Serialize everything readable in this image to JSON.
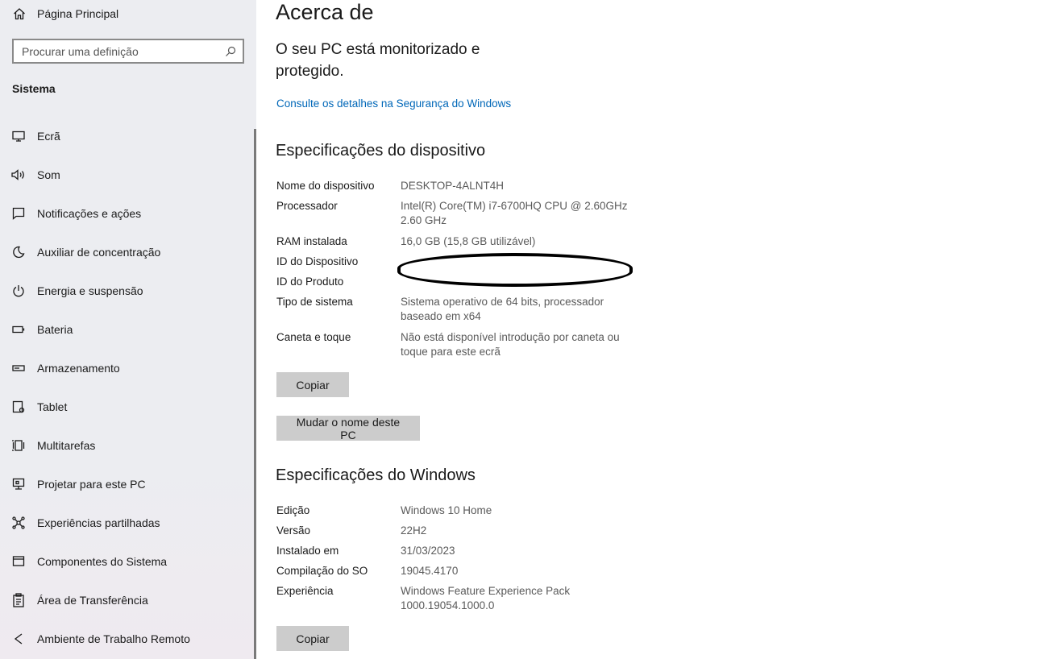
{
  "sidebar": {
    "home_label": "Página Principal",
    "search_placeholder": "Procurar uma definição",
    "section_title": "Sistema",
    "items": [
      {
        "label": "Ecrã",
        "icon": "display-icon"
      },
      {
        "label": "Som",
        "icon": "speaker-icon"
      },
      {
        "label": "Notificações e ações",
        "icon": "notification-icon"
      },
      {
        "label": "Auxiliar de concentração",
        "icon": "moon-icon"
      },
      {
        "label": "Energia e suspensão",
        "icon": "power-icon"
      },
      {
        "label": "Bateria",
        "icon": "battery-icon"
      },
      {
        "label": "Armazenamento",
        "icon": "storage-icon"
      },
      {
        "label": "Tablet",
        "icon": "tablet-icon"
      },
      {
        "label": "Multitarefas",
        "icon": "multitask-icon"
      },
      {
        "label": "Projetar para este PC",
        "icon": "project-icon"
      },
      {
        "label": "Experiências partilhadas",
        "icon": "shared-icon"
      },
      {
        "label": "Componentes do Sistema",
        "icon": "components-icon"
      },
      {
        "label": "Área de Transferência",
        "icon": "clipboard-icon"
      },
      {
        "label": "Ambiente de Trabalho Remoto",
        "icon": "remote-icon"
      }
    ]
  },
  "main": {
    "title": "Acerca de",
    "protect_text": "O seu PC está monitorizado e protegido.",
    "security_link": "Consulte os detalhes na Segurança do Windows",
    "device_specs": {
      "heading": "Especificações do dispositivo",
      "rows": [
        {
          "key": "Nome do dispositivo",
          "value": "DESKTOP-4ALNT4H"
        },
        {
          "key": "Processador",
          "value": "Intel(R) Core(TM) i7-6700HQ CPU @ 2.60GHz 2.60 GHz"
        },
        {
          "key": "RAM instalada",
          "value": "16,0 GB (15,8 GB utilizável)"
        },
        {
          "key": "ID do Dispositivo",
          "value": ""
        },
        {
          "key": "ID do Produto",
          "value": ""
        },
        {
          "key": "Tipo de sistema",
          "value": "Sistema operativo de 64 bits, processador baseado em x64"
        },
        {
          "key": "Caneta e toque",
          "value": "Não está disponível introdução por caneta ou toque para este ecrã"
        }
      ],
      "copy_label": "Copiar",
      "rename_label": "Mudar o nome deste PC"
    },
    "windows_specs": {
      "heading": "Especificações do Windows",
      "rows": [
        {
          "key": "Edição",
          "value": "Windows 10 Home"
        },
        {
          "key": "Versão",
          "value": "22H2"
        },
        {
          "key": "Instalado em",
          "value": "31/03/2023"
        },
        {
          "key": "Compilação do SO",
          "value": "19045.4170"
        },
        {
          "key": "Experiência",
          "value": "Windows Feature Experience Pack 1000.19054.1000.0"
        }
      ],
      "copy_label": "Copiar"
    }
  }
}
